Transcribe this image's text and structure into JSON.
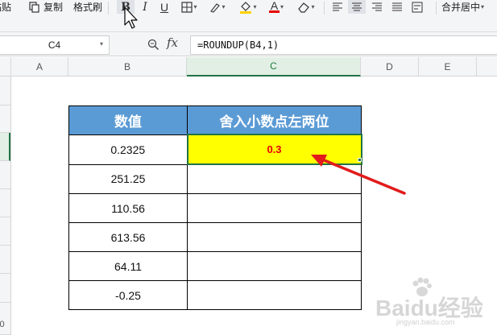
{
  "ribbon": {
    "paste_label": "粘贴",
    "copy_label": "复制",
    "format_painter_label": "格式刷",
    "bold_label": "B",
    "italic_label": "I",
    "underline_label": "U",
    "font_color_letter": "A",
    "merge_center_label": "合并居中",
    "fill_color": "#ffd200",
    "font_color": "#e60000"
  },
  "formula_bar": {
    "name_box": "C4",
    "fx_label": "fx",
    "formula": "=ROUNDUP(B4,1)"
  },
  "columns": [
    "A",
    "B",
    "C",
    "D",
    "E"
  ],
  "active_column": "C",
  "row_header_partial_digit": "0",
  "table": {
    "headers": [
      "数值",
      "舍入小数点左两位"
    ],
    "rows": [
      [
        "0.2325",
        "0.3"
      ],
      [
        "251.25",
        ""
      ],
      [
        "110.56",
        ""
      ],
      [
        "613.56",
        ""
      ],
      [
        "64.11",
        ""
      ],
      [
        "-0.25",
        ""
      ]
    ],
    "header_color": "#5b9bd5",
    "highlight_color": "#ffff00",
    "result_text_color": "#e60000",
    "selection_color": "#217346"
  },
  "annotation": {
    "arrow_color": "#e21b1b"
  },
  "watermark": {
    "text": "Baidu经验",
    "sub_text": "jingyan.baidu.com"
  }
}
